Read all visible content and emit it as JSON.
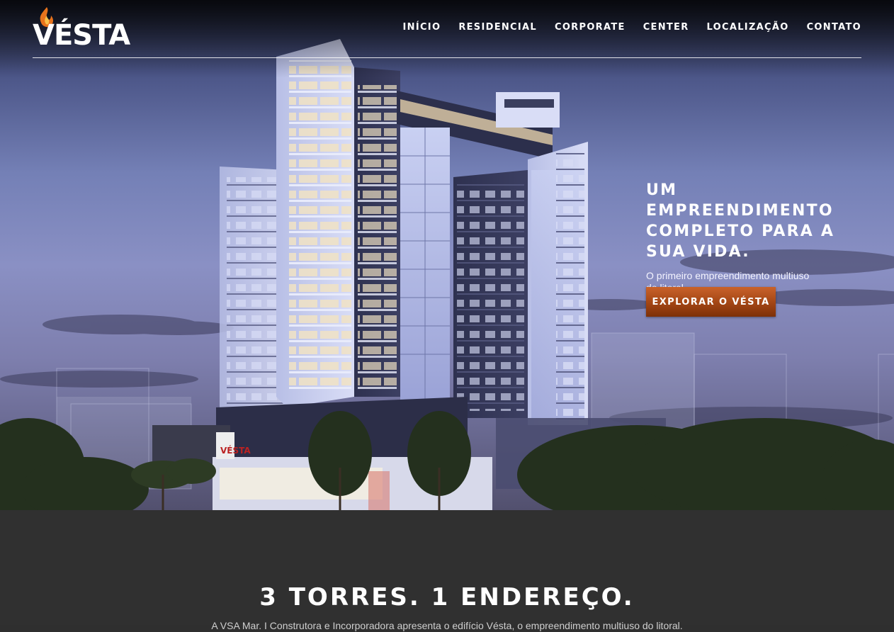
{
  "brand": {
    "name": "VÉSTA"
  },
  "nav": {
    "items": [
      {
        "label": "INÍCIO"
      },
      {
        "label": "RESIDENCIAL"
      },
      {
        "label": "CORPORATE"
      },
      {
        "label": "CENTER"
      },
      {
        "label": "LOCALIZAÇÃO"
      },
      {
        "label": "CONTATO"
      }
    ]
  },
  "hero": {
    "title_lines": [
      "UM EMPREENDIMENTO",
      "COMPLETO PARA A",
      "SUA VIDA."
    ],
    "subtitle": "O primeiro empreendimento multiuso do litoral.",
    "cta_label": "EXPLORAR O VÉSTA",
    "sign_text": "VÉSTA"
  },
  "section": {
    "title": "3 TORRES. 1 ENDEREÇO.",
    "text": "A VSA Mar. I Construtora e Incorporadora apresenta o edifício Vésta, o empreendimento multiuso do litoral."
  },
  "colors": {
    "accent": "#b5541c",
    "accent_dark": "#7d3008",
    "section_bg": "#303030",
    "flame": "#e8731c"
  }
}
